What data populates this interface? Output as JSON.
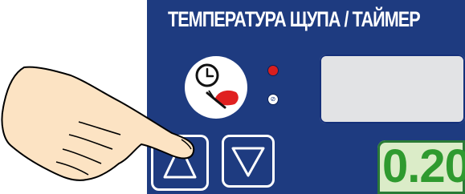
{
  "panel": {
    "title": "ТЕМПЕРАТУРА ЩУПА / ТАЙМЕР",
    "background_color": "#1e3b80",
    "mode_icon": "clock-probe-icon",
    "indicators": [
      {
        "name": "red-led",
        "color": "#d81e1e"
      },
      {
        "name": "status-led",
        "color": "#ffffff",
        "glyph": "⊘"
      }
    ],
    "top_display": {
      "value": "",
      "color": "#e2e3e5"
    },
    "bottom_display": {
      "value": "0.20",
      "color": "#2f9a2f"
    },
    "buttons": [
      {
        "name": "up-arrow-button",
        "icon": "triangle-up-icon"
      },
      {
        "name": "down-arrow-button",
        "icon": "triangle-down-icon"
      }
    ]
  },
  "overlay": {
    "icon": "pointing-hand-icon"
  }
}
